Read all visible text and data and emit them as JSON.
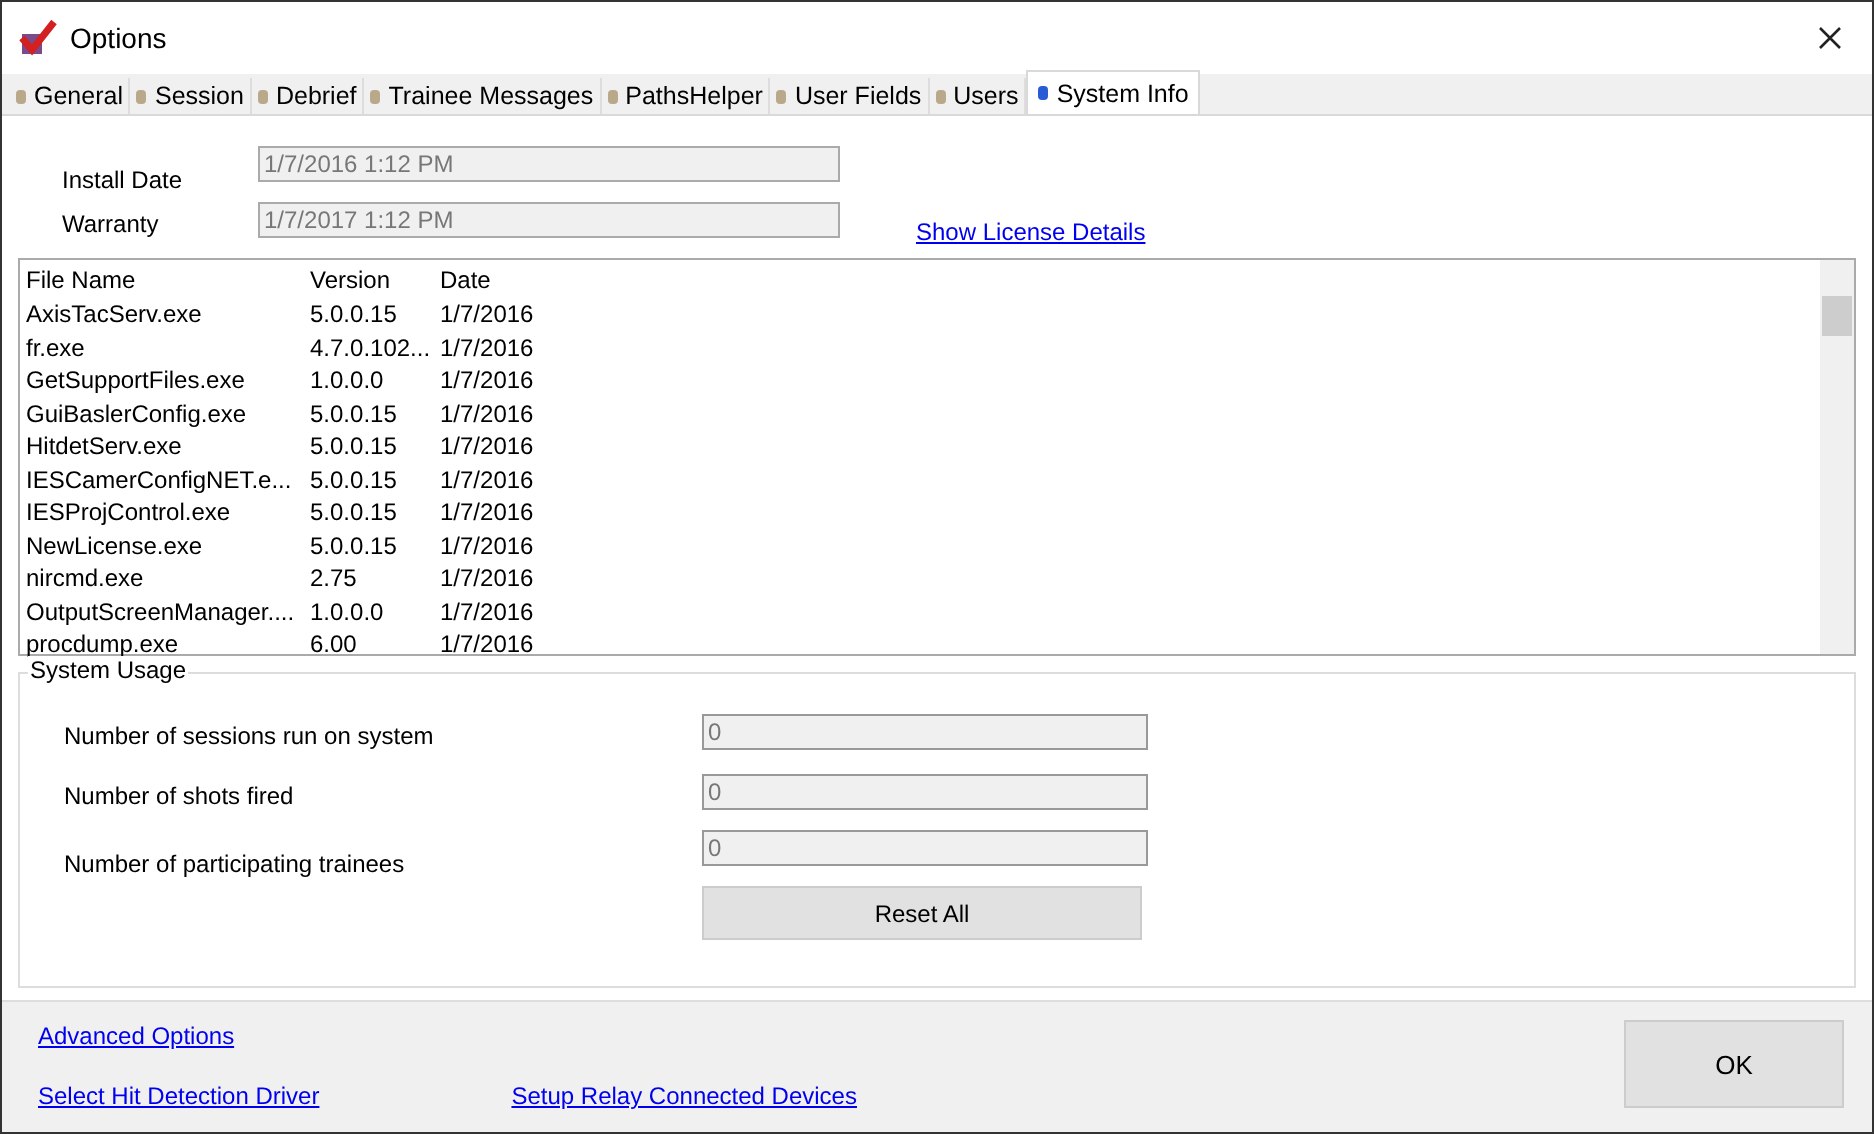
{
  "window": {
    "title": "Options"
  },
  "tabs": [
    {
      "label": "General",
      "selected": false
    },
    {
      "label": "Session",
      "selected": false
    },
    {
      "label": "Debrief",
      "selected": false
    },
    {
      "label": "Trainee Messages",
      "selected": false
    },
    {
      "label": "PathsHelper",
      "selected": false
    },
    {
      "label": "User Fields",
      "selected": false
    },
    {
      "label": "Users",
      "selected": false
    },
    {
      "label": "System Info",
      "selected": true
    }
  ],
  "install": [
    {
      "label": "Install Date",
      "value": "1/7/2016 1:12 PM"
    },
    {
      "label": "Warranty",
      "value": "1/7/2017 1:12 PM"
    }
  ],
  "license_link": "Show License Details",
  "files": {
    "columns": [
      "File Name",
      "Version",
      "Date"
    ],
    "rows": [
      [
        "AxisTacServ.exe",
        "5.0.0.15",
        "1/7/2016"
      ],
      [
        "fr.exe",
        "4.7.0.102...",
        "1/7/2016"
      ],
      [
        "GetSupportFiles.exe",
        "1.0.0.0",
        "1/7/2016"
      ],
      [
        "GuiBaslerConfig.exe",
        "5.0.0.15",
        "1/7/2016"
      ],
      [
        "HitdetServ.exe",
        "5.0.0.15",
        "1/7/2016"
      ],
      [
        "IESCamerConfigNET.e...",
        "5.0.0.15",
        "1/7/2016"
      ],
      [
        "IESProjControl.exe",
        "5.0.0.15",
        "1/7/2016"
      ],
      [
        "NewLicense.exe",
        "5.0.0.15",
        "1/7/2016"
      ],
      [
        "nircmd.exe",
        "2.75",
        "1/7/2016"
      ],
      [
        "OutputScreenManager....",
        "1.0.0.0",
        "1/7/2016"
      ],
      [
        "procdump.exe",
        "6.00",
        "1/7/2016"
      ]
    ]
  },
  "system_usage": {
    "title": "System Usage",
    "fields": [
      {
        "label": "Number of sessions run on system",
        "value": "0"
      },
      {
        "label": "Number of shots fired",
        "value": "0"
      },
      {
        "label": "Number of participating trainees",
        "value": "0"
      }
    ],
    "reset_button": "Reset All"
  },
  "footer": {
    "links": [
      "Advanced Options",
      "Select Hit Detection Driver",
      "Setup Relay Connected Devices"
    ],
    "ok_button": "OK"
  }
}
